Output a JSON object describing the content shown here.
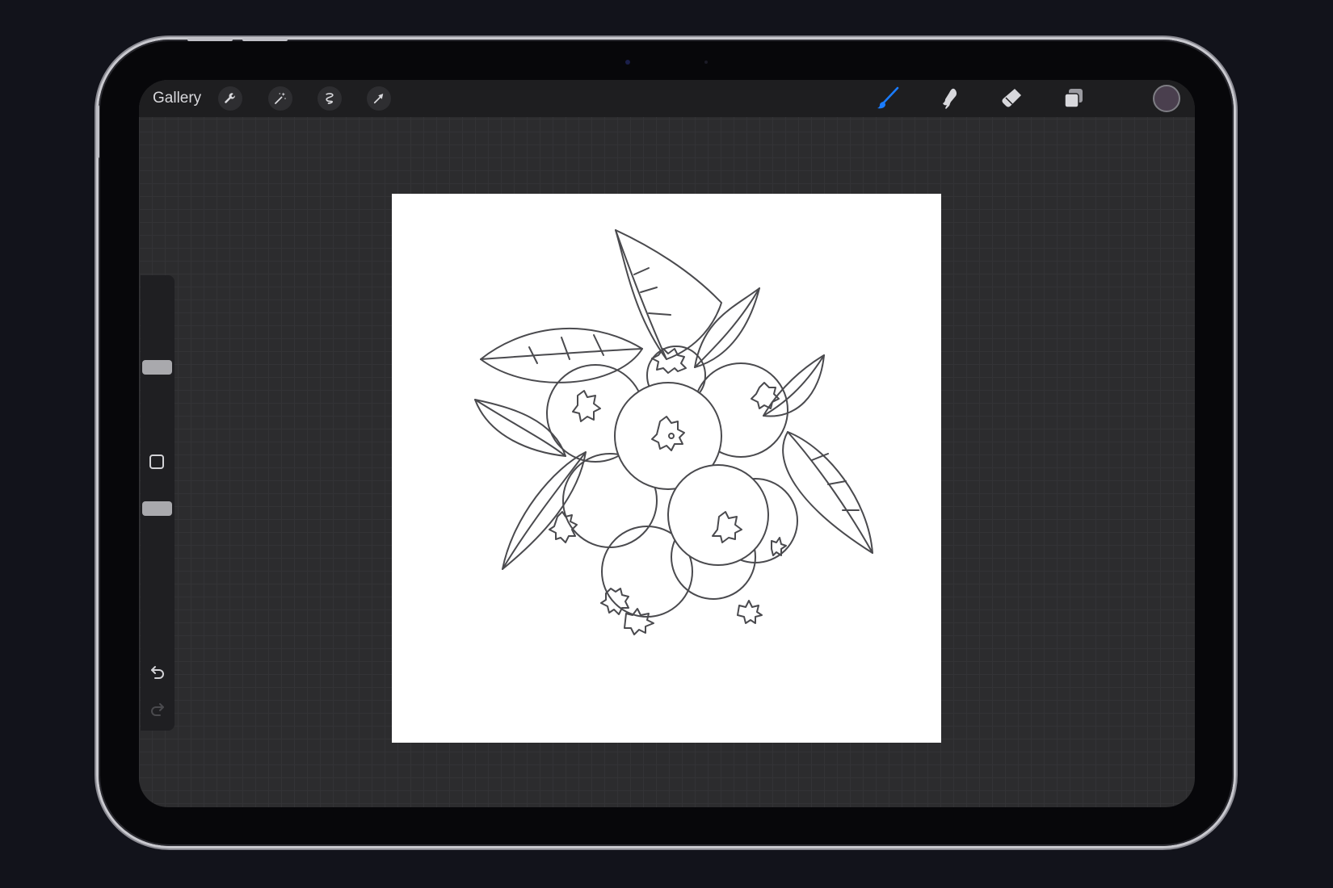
{
  "toolbar": {
    "gallery_label": "Gallery",
    "left_tools": [
      "actions-icon",
      "adjustments-icon",
      "selection-icon",
      "transform-icon"
    ],
    "right_tools": [
      "brush-icon",
      "smudge-icon",
      "eraser-icon",
      "layers-icon"
    ],
    "active_tool": "brush",
    "accent_color": "#1a7cff",
    "current_color": "#4a3f4e"
  },
  "sidebar": {
    "brush_size_level": 0.4,
    "opacity_level": 0.4,
    "controls": [
      "brush-size-slider",
      "modify-button",
      "opacity-slider",
      "undo-button",
      "redo-button"
    ]
  },
  "canvas": {
    "artwork": "blueberry-branch-line-drawing",
    "background": "#ffffff"
  }
}
